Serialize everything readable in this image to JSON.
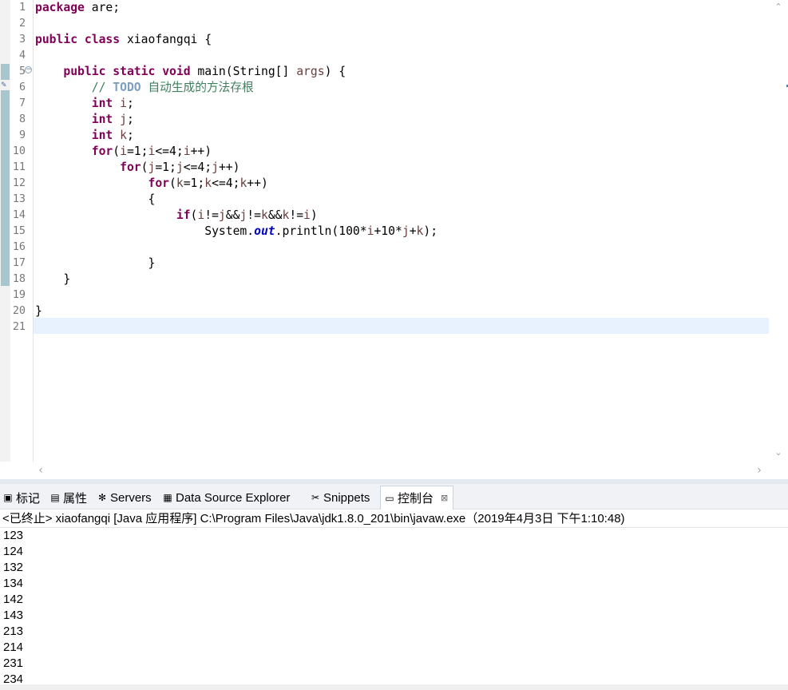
{
  "editor": {
    "line_numbers": [
      "1",
      "2",
      "3",
      "4",
      "5",
      "6",
      "7",
      "8",
      "9",
      "10",
      "11",
      "12",
      "13",
      "14",
      "15",
      "16",
      "17",
      "18",
      "19",
      "20",
      "21"
    ],
    "code": [
      [
        {
          "t": "package",
          "c": "kw"
        },
        {
          "t": " are;"
        }
      ],
      [],
      [
        {
          "t": "public",
          "c": "kw"
        },
        {
          "t": " "
        },
        {
          "t": "class",
          "c": "kw"
        },
        {
          "t": " xiaofangqi {"
        }
      ],
      [],
      [
        {
          "t": "    "
        },
        {
          "t": "public",
          "c": "kw"
        },
        {
          "t": " "
        },
        {
          "t": "static",
          "c": "kw"
        },
        {
          "t": " "
        },
        {
          "t": "void",
          "c": "kw"
        },
        {
          "t": " main(String[] "
        },
        {
          "t": "args",
          "c": "var"
        },
        {
          "t": ") {"
        }
      ],
      [
        {
          "t": "        "
        },
        {
          "t": "// ",
          "c": "cm"
        },
        {
          "t": "TODO",
          "c": "todo"
        },
        {
          "t": " 自动生成的方法存根",
          "c": "cm"
        }
      ],
      [
        {
          "t": "        "
        },
        {
          "t": "int",
          "c": "kw"
        },
        {
          "t": " "
        },
        {
          "t": "i",
          "c": "var"
        },
        {
          "t": ";"
        }
      ],
      [
        {
          "t": "        "
        },
        {
          "t": "int",
          "c": "kw"
        },
        {
          "t": " "
        },
        {
          "t": "j",
          "c": "var"
        },
        {
          "t": ";"
        }
      ],
      [
        {
          "t": "        "
        },
        {
          "t": "int",
          "c": "kw"
        },
        {
          "t": " "
        },
        {
          "t": "k",
          "c": "var"
        },
        {
          "t": ";"
        }
      ],
      [
        {
          "t": "        "
        },
        {
          "t": "for",
          "c": "kw"
        },
        {
          "t": "("
        },
        {
          "t": "i",
          "c": "var"
        },
        {
          "t": "=1;"
        },
        {
          "t": "i",
          "c": "var"
        },
        {
          "t": "<=4;"
        },
        {
          "t": "i",
          "c": "var"
        },
        {
          "t": "++)"
        }
      ],
      [
        {
          "t": "            "
        },
        {
          "t": "for",
          "c": "kw"
        },
        {
          "t": "("
        },
        {
          "t": "j",
          "c": "var"
        },
        {
          "t": "=1;"
        },
        {
          "t": "j",
          "c": "var"
        },
        {
          "t": "<=4;"
        },
        {
          "t": "j",
          "c": "var"
        },
        {
          "t": "++)"
        }
      ],
      [
        {
          "t": "                "
        },
        {
          "t": "for",
          "c": "kw"
        },
        {
          "t": "("
        },
        {
          "t": "k",
          "c": "var"
        },
        {
          "t": "=1;"
        },
        {
          "t": "k",
          "c": "var"
        },
        {
          "t": "<=4;"
        },
        {
          "t": "k",
          "c": "var"
        },
        {
          "t": "++)"
        }
      ],
      [
        {
          "t": "                {"
        }
      ],
      [
        {
          "t": "                    "
        },
        {
          "t": "if",
          "c": "kw"
        },
        {
          "t": "("
        },
        {
          "t": "i",
          "c": "var"
        },
        {
          "t": "!="
        },
        {
          "t": "j",
          "c": "var"
        },
        {
          "t": "&&"
        },
        {
          "t": "j",
          "c": "var"
        },
        {
          "t": "!="
        },
        {
          "t": "k",
          "c": "var"
        },
        {
          "t": "&&"
        },
        {
          "t": "k",
          "c": "var"
        },
        {
          "t": "!="
        },
        {
          "t": "i",
          "c": "var"
        },
        {
          "t": ")"
        }
      ],
      [
        {
          "t": "                        System."
        },
        {
          "t": "out",
          "c": "fld"
        },
        {
          "t": ".println(100*"
        },
        {
          "t": "i",
          "c": "var"
        },
        {
          "t": "+10*"
        },
        {
          "t": "j",
          "c": "var"
        },
        {
          "t": "+"
        },
        {
          "t": "k",
          "c": "var"
        },
        {
          "t": ");"
        }
      ],
      [],
      [
        {
          "t": "                }"
        }
      ],
      [
        {
          "t": "    }"
        }
      ],
      [],
      [
        {
          "t": "}"
        }
      ],
      []
    ]
  },
  "tabs": [
    {
      "label": "标记",
      "icon": "markers-icon",
      "glyph": "▣"
    },
    {
      "label": "属性",
      "icon": "properties-icon",
      "glyph": "▤"
    },
    {
      "label": "Servers",
      "icon": "servers-icon",
      "glyph": "✻"
    },
    {
      "label": "Data Source Explorer",
      "icon": "data-source-icon",
      "glyph": "▦"
    },
    {
      "label": "Snippets",
      "icon": "snippets-icon",
      "glyph": "✂"
    },
    {
      "label": "控制台",
      "icon": "console-icon",
      "glyph": "▭",
      "active": true,
      "close": "⊠"
    }
  ],
  "console": {
    "header": "<已终止> xiaofangqi [Java 应用程序] C:\\Program Files\\Java\\jdk1.8.0_201\\bin\\javaw.exe（2019年4月3日 下午1:10:48)",
    "output": [
      "123",
      "124",
      "132",
      "134",
      "142",
      "143",
      "213",
      "214",
      "231",
      "234"
    ]
  },
  "scroll": {
    "up": "⌃",
    "down": "⌄",
    "left": "‹",
    "right": "›"
  },
  "colors": {
    "keyword": "#7f0055",
    "variable": "#6a3e3e",
    "comment": "#3f7f5f",
    "todo": "#7f9fbf",
    "field": "#0000c0",
    "current_line": "#e8f2fe",
    "change_bar": "#a7c6cd"
  }
}
